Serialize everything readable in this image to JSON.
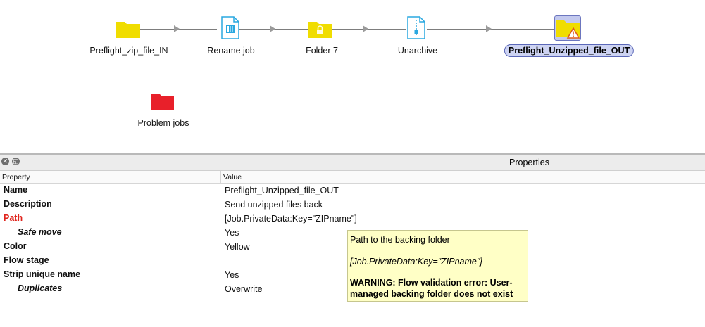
{
  "flow": {
    "nodes": [
      {
        "id": "preflight-zip-in",
        "label": "Preflight_zip_file_IN",
        "icon": "folder-icon",
        "color": "#f0dd00"
      },
      {
        "id": "rename-job",
        "label": "Rename job",
        "icon": "rename-job-icon",
        "color": "#2aa8e0"
      },
      {
        "id": "folder-7",
        "label": "Folder 7",
        "icon": "locked-folder-icon",
        "color": "#f0dd00"
      },
      {
        "id": "unarchive",
        "label": "Unarchive",
        "icon": "unarchive-icon",
        "color": "#2aa8e0"
      },
      {
        "id": "preflight-unzipped-out",
        "label": "Preflight_Unzipped_file_OUT",
        "icon": "folder-warning-icon",
        "color": "#f0dd00",
        "selected": true
      },
      {
        "id": "problem-jobs",
        "label": "Problem jobs",
        "icon": "problem-folder-icon",
        "color": "#e8202a"
      }
    ]
  },
  "properties": {
    "title": "Properties",
    "col_property": "Property",
    "col_value": "Value",
    "rows": [
      {
        "name": "Name",
        "value": "Preflight_Unzipped_file_OUT"
      },
      {
        "name": "Description",
        "value": "Send unzipped files back"
      },
      {
        "name": "Path",
        "value": "[Job.PrivateData:Key=\"ZIPname\"]"
      },
      {
        "name": "Safe move",
        "value": "Yes"
      },
      {
        "name": "Color",
        "value": "Yellow"
      },
      {
        "name": "Flow stage",
        "value": ""
      },
      {
        "name": "Strip unique name",
        "value": "Yes"
      },
      {
        "name": "Duplicates",
        "value": "Overwrite"
      }
    ]
  },
  "tooltip": {
    "line1": "Path to the backing folder",
    "line2": "[Job.PrivateData:Key=\"ZIPname\"]",
    "warn1": "WARNING: Flow validation error: User-",
    "warn2": "managed backing folder does not exist"
  },
  "colors": {
    "error": "#e0231b",
    "folder_yellow": "#f0dd00",
    "folder_red": "#e8202a",
    "tooltip_bg": "#ffffc6"
  }
}
